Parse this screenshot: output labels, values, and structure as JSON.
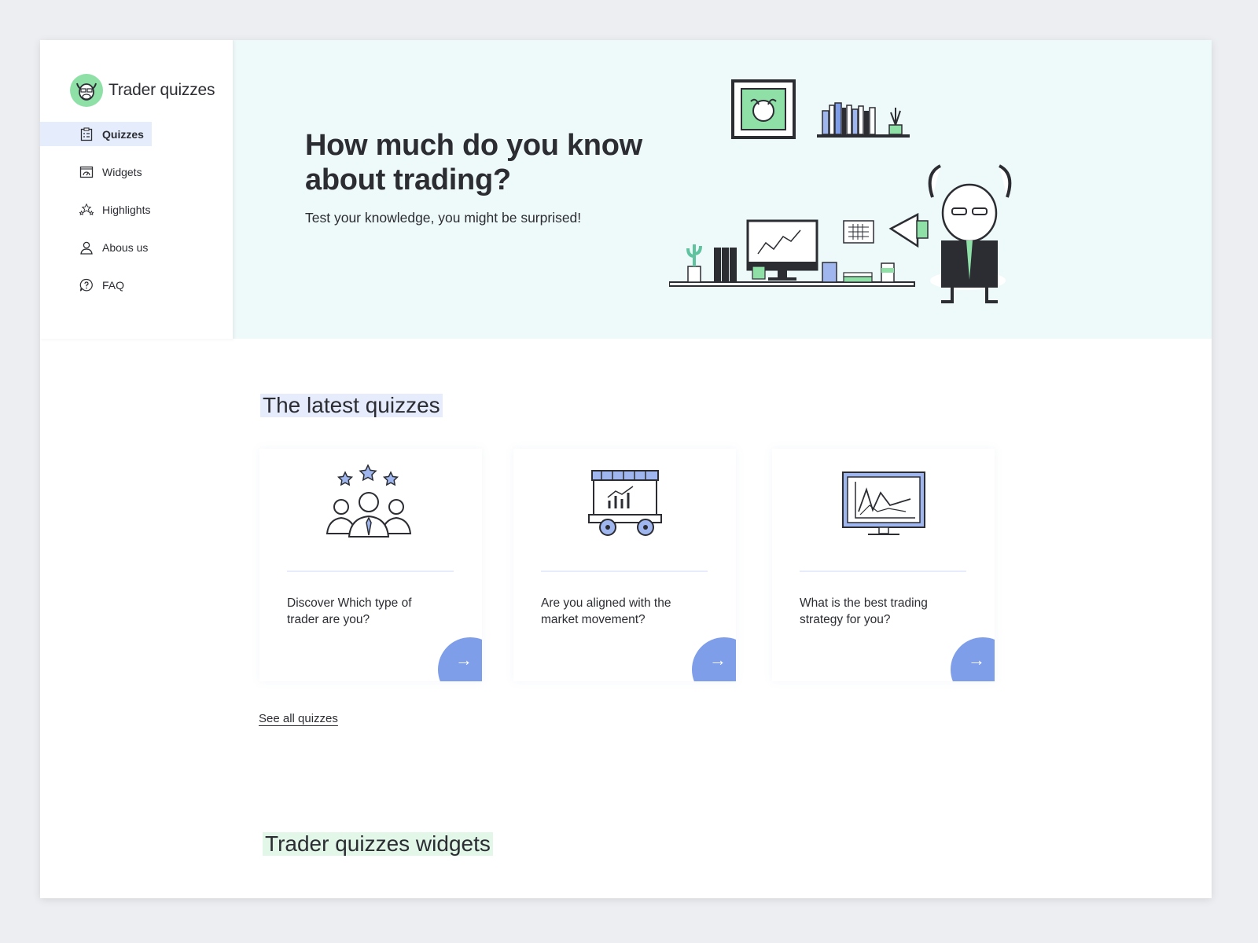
{
  "brand": {
    "name": "Trader quizzes",
    "logo_icon": "bull-head-icon",
    "logo_color": "#8ee0a6"
  },
  "sidebar": {
    "items": [
      {
        "label": "Quizzes",
        "icon": "clipboard-icon",
        "active": true
      },
      {
        "label": "Widgets",
        "icon": "dashboard-icon",
        "active": false
      },
      {
        "label": "Highlights",
        "icon": "stars-icon",
        "active": false
      },
      {
        "label": "Abous us",
        "icon": "user-icon",
        "active": false
      },
      {
        "label": "FAQ",
        "icon": "question-bubble-icon",
        "active": false
      }
    ]
  },
  "hero": {
    "title": "How much do you know about trading?",
    "subtitle": "Test your knowledge, you might be surprised!",
    "background": "#eef9f9"
  },
  "latest": {
    "title": "The latest quizzes",
    "cards": [
      {
        "text": "Discover Which type of trader are you?",
        "icon": "rated-team-icon"
      },
      {
        "text": "Are you aligned with the market movement?",
        "icon": "market-cart-icon"
      },
      {
        "text": "What is the best trading strategy for you?",
        "icon": "chart-monitor-icon"
      }
    ],
    "see_all": "See all quizzes"
  },
  "widgets": {
    "title": "Trader quizzes widgets"
  },
  "colors": {
    "accent_blue": "#7f9ee9",
    "highlight_blue": "#e6ecfb",
    "highlight_green": "#e2f7e7",
    "text": "#2b2d33"
  }
}
